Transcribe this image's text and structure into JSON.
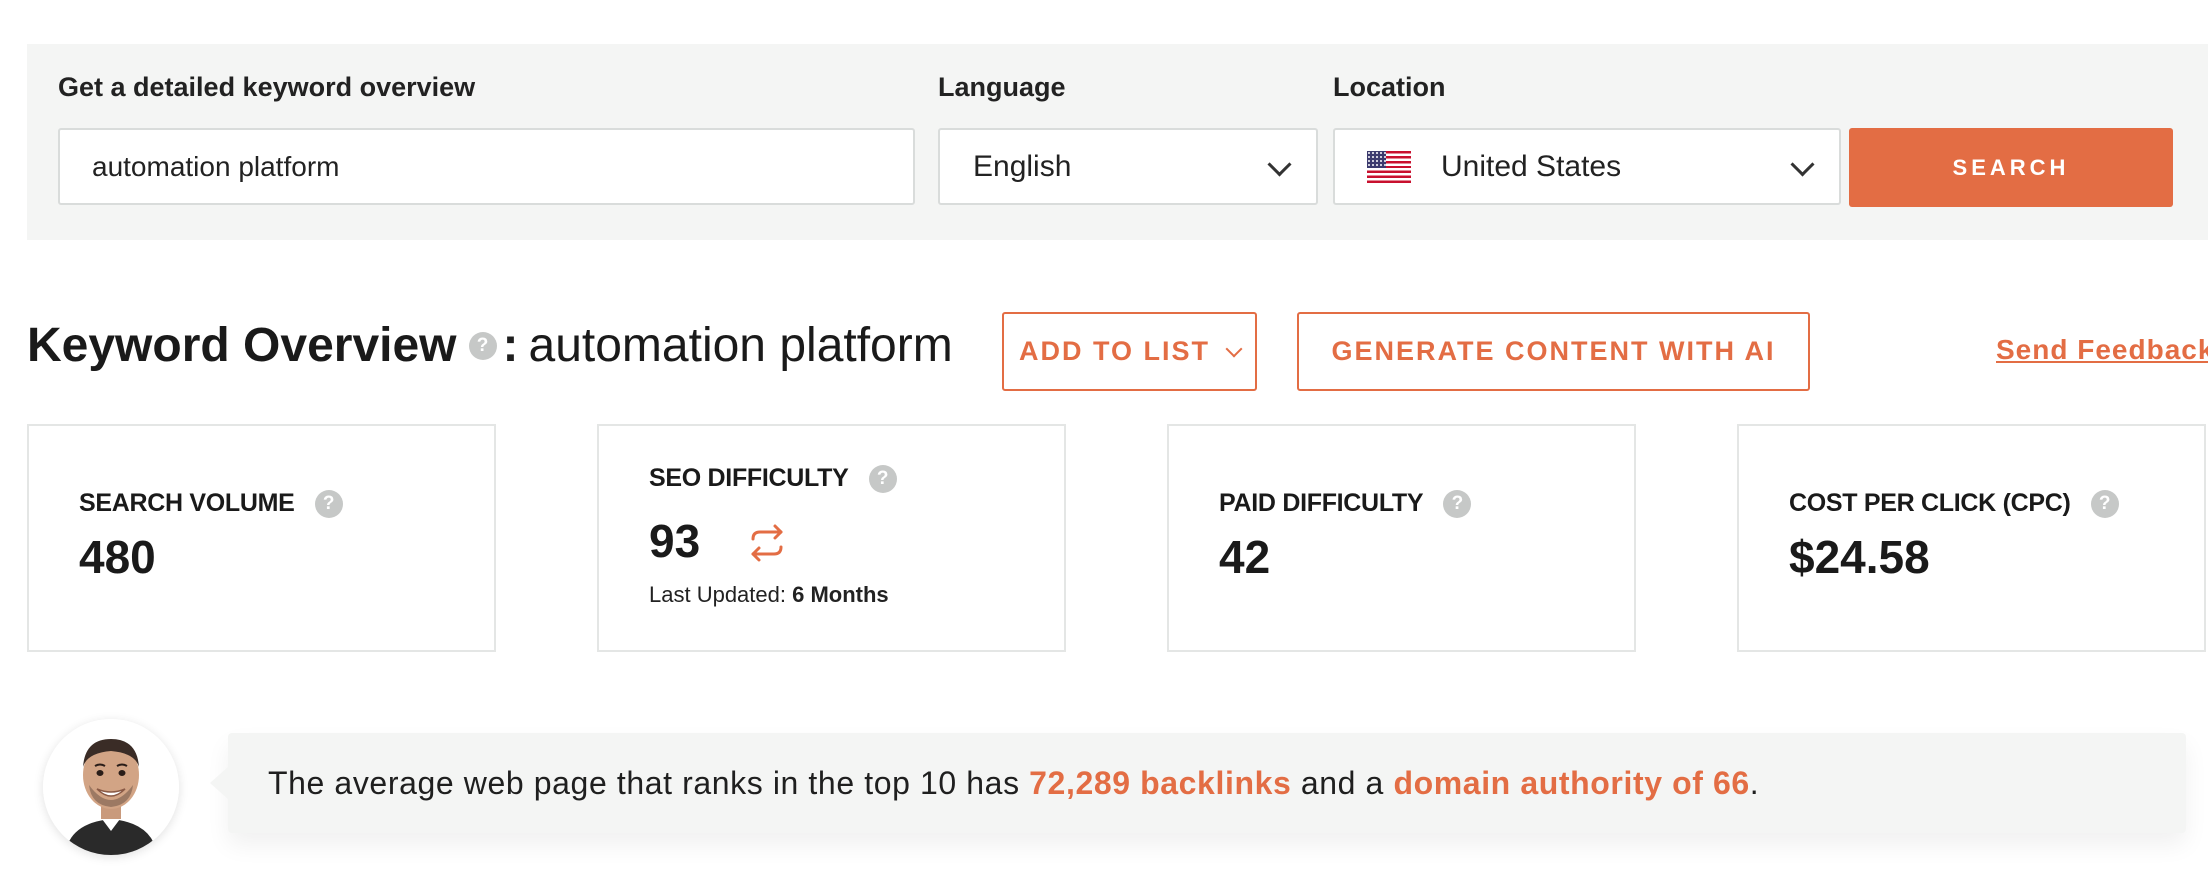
{
  "search": {
    "keyword_label": "Get a detailed keyword overview",
    "keyword_value": "automation platform",
    "language_label": "Language",
    "language_value": "English",
    "location_label": "Location",
    "location_value": "United States",
    "location_flag": "us-flag-icon",
    "search_button": "SEARCH"
  },
  "overview": {
    "title": "Keyword Overview",
    "help": "?",
    "colon": ":",
    "term": "automation platform",
    "add_to_list": "ADD TO LIST",
    "generate_content": "GENERATE CONTENT WITH AI",
    "send_feedback": "Send Feedback"
  },
  "metrics": [
    {
      "label": "SEARCH VOLUME",
      "value": "480"
    },
    {
      "label": "SEO DIFFICULTY",
      "value": "93",
      "last_updated_label": "Last Updated:",
      "last_updated_value": "6 Months"
    },
    {
      "label": "PAID DIFFICULTY",
      "value": "42"
    },
    {
      "label": "COST PER CLICK (CPC)",
      "value": "$24.58"
    }
  ],
  "tip": {
    "text_before": "The average web page that ranks in the top 10 has ",
    "backlinks": "72,289 backlinks",
    "text_middle": " and a ",
    "domain_authority": "domain authority of 66",
    "text_after": "."
  },
  "colors": {
    "accent": "#e36d44",
    "panel_bg": "#f4f5f4",
    "border": "#d9dcdb"
  }
}
